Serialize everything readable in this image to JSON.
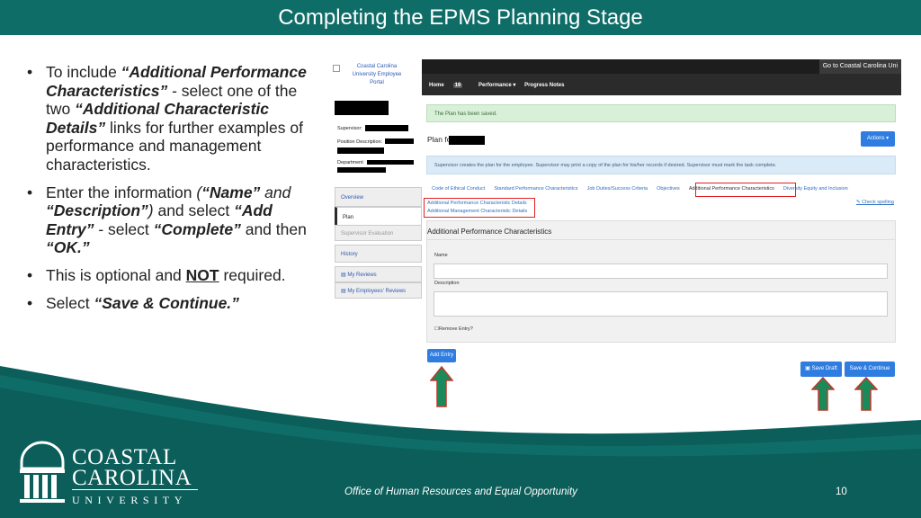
{
  "slide": {
    "title": "Completing the EPMS Planning Stage",
    "footer": "Office of Human Resources and Equal Opportunity",
    "page_number": "10",
    "colors": {
      "teal": "#0f6d68",
      "teal_dark": "#0b5e5a",
      "highlight_red": "#e02020",
      "arrow_green": "#1b8a5a",
      "button_blue": "#2f7de0"
    }
  },
  "bullets": {
    "b1": {
      "t1": "To include ",
      "t2": "“Additional Performance Characteristics”",
      "t3": " - select one of the two ",
      "t4": "“Additional Characteristic Details”",
      "t5": " links for further examples of performance and management characteristics."
    },
    "b2": {
      "t1": "Enter the information ",
      "t2": "(",
      "t3": "“Name”",
      "t4": " and ",
      "t5": "“Description”",
      "t6": ")",
      "t7": " and select ",
      "t8": "“Add Entry”",
      "t9": " - select ",
      "t10": "“Complete”",
      "t11": " and then ",
      "t12": "“OK.”"
    },
    "b3": {
      "t1": "This is optional and ",
      "t2": "NOT",
      "t3": " required."
    },
    "b4": {
      "t1": "Select ",
      "t2": "“Save & Continue.”"
    }
  },
  "screenshot": {
    "portal_logo": "Coastal Carolina University Employee Portal",
    "goto": "Go to Coastal Carolina Uni",
    "nav": {
      "home": "Home",
      "home_badge": "16",
      "performance": "Performance ▾",
      "progress_notes": "Progress Notes"
    },
    "fields": {
      "supervisor": "Supervisor:",
      "position": "Position Description:",
      "department": "Department"
    },
    "sidebar": {
      "overview": "Overview",
      "plan": "Plan",
      "supervisor_eval": "Supervisor Evaluation",
      "history": "History",
      "my_reviews": "My Reviews",
      "employee_reviews": "My Employees' Reviews"
    },
    "saved_message": "The Plan has been saved.",
    "plan_title": "Plan fo",
    "actions_label": "Actions ▾",
    "info_message": "Supervisor creates the plan for the employee. Supervisor may print a copy of the plan for his/her records if desired. Supervisor must mark the task complete.",
    "tabs": [
      "Code of Ethical Conduct",
      "Standard Performance Characteristics",
      "Job Duties/Success Criteria",
      "Objectives",
      "Additional Performance Characteristics",
      "Diversity Equity and Inclusion"
    ],
    "detail_links": [
      "Additional Performance Characteristic Details",
      "Additional Management Characteristic Details"
    ],
    "check_spelling": "Check spelling",
    "panel_title": "Additional Performance Characteristics",
    "name_label": "Name",
    "description_label": "Description",
    "remove_entry": "Remove Entry?",
    "add_entry": "Add Entry",
    "save_draft": "Save Draft",
    "save_continue": "Save & Continue"
  },
  "logo": {
    "name_line1": "COASTAL",
    "name_line2": "CAROLINA",
    "university": "UNIVERSITY"
  }
}
